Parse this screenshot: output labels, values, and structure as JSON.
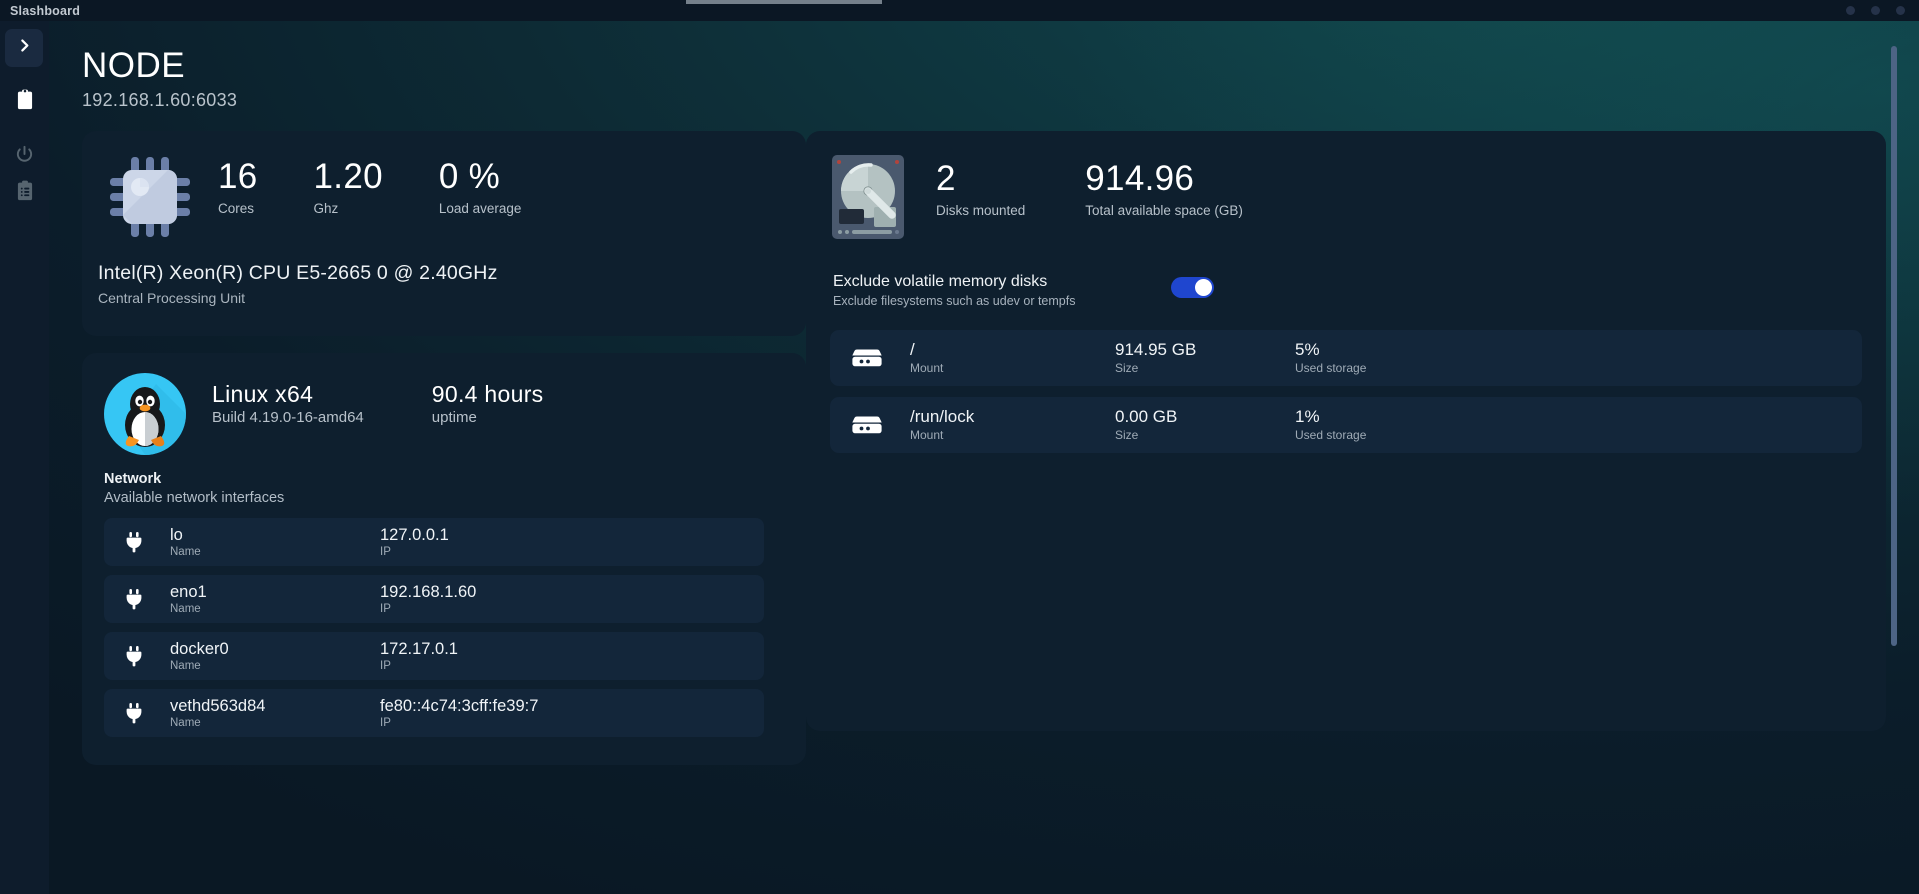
{
  "titlebar": {
    "app_title": "Slashboard",
    "window_controls": [
      "minimize-dot",
      "maximize-dot",
      "close-dot"
    ]
  },
  "sidebar": {
    "toggle": {
      "icon": "chevron-right-icon",
      "label": "Expand sidebar"
    },
    "items": [
      {
        "icon": "clipboard-icon",
        "label": "Boards",
        "active": true
      },
      {
        "icon": "power-icon",
        "label": "Power"
      },
      {
        "icon": "clipboard-list-icon",
        "label": "Logs"
      }
    ]
  },
  "header": {
    "title": "NODE",
    "subtitle": "192.168.1.60:6033"
  },
  "cpu": {
    "icon": "cpu-chip-icon",
    "metrics": [
      {
        "value": "16",
        "label": "Cores"
      },
      {
        "value": "1.20",
        "label": "Ghz"
      },
      {
        "value": "0 %",
        "label": "Load average"
      }
    ],
    "model_name": "Intel(R) Xeon(R) CPU E5-2665 0 @ 2.40GHz",
    "model_desc": "Central Processing Unit"
  },
  "os": {
    "icon": "linux-penguin-icon",
    "metrics": [
      {
        "value": "Linux x64",
        "label": "Build 4.19.0-16-amd64"
      },
      {
        "value": "90.4 hours",
        "label": "uptime"
      }
    ]
  },
  "network": {
    "heading": "Network",
    "subheading": "Available network interfaces",
    "columns": {
      "name": "Name",
      "ip": "IP"
    },
    "interfaces": [
      {
        "icon": "plug-icon",
        "name": "lo",
        "ip": "127.0.0.1"
      },
      {
        "icon": "plug-icon",
        "name": "eno1",
        "ip": "192.168.1.60"
      },
      {
        "icon": "plug-icon",
        "name": "docker0",
        "ip": "172.17.0.1"
      },
      {
        "icon": "plug-icon",
        "name": "vethd563d84",
        "ip": "fe80::4c74:3cff:fe39:7"
      }
    ]
  },
  "disks": {
    "icon": "hard-drive-icon",
    "metrics": [
      {
        "value": "2",
        "label": "Disks mounted"
      },
      {
        "value": "914.96",
        "label": "Total available space (GB)"
      }
    ],
    "exclude": {
      "title": "Exclude volatile memory disks",
      "description": "Exclude filesystems such as udev or tempfs",
      "enabled": true,
      "accent_color": "#1f46cf"
    },
    "columns": {
      "mount": "Mount",
      "size": "Size",
      "used": "Used storage"
    },
    "rows": [
      {
        "icon": "disk-icon",
        "mount": "/",
        "size": "914.95 GB",
        "used": "5%"
      },
      {
        "icon": "disk-icon",
        "mount": "/run/lock",
        "size": "0.00 GB",
        "used": "1%"
      }
    ]
  },
  "scrollbars": {
    "page": "page-scrollbar",
    "network_list": "network-list-scrollbar"
  },
  "theme": {
    "background": "#0b1a26",
    "card": "#0e1f2e",
    "row": "#13263a",
    "sidebar": "#0e1c2c",
    "accent": "#1f46cf",
    "text": "#ffffff",
    "muted": "#b0bbc5"
  }
}
